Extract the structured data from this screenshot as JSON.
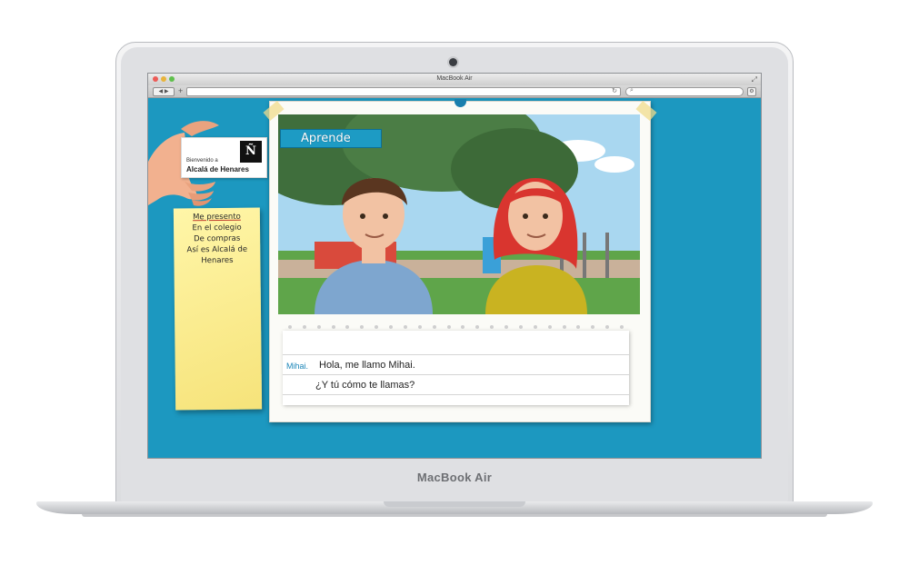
{
  "device": {
    "brand": "MacBook Air"
  },
  "window": {
    "title": "MacBook Air"
  },
  "card": {
    "line1": "Bienvenido a",
    "line2": "Alcalá de Henares",
    "logo_text": "Ñ"
  },
  "menu": {
    "items": [
      {
        "label": "Me presento"
      },
      {
        "label": "En el colegio"
      },
      {
        "label": "De compras"
      },
      {
        "label": "Así es Alcalá de"
      },
      {
        "label": "Henares"
      }
    ]
  },
  "panel": {
    "heading": "Aprende",
    "speaker": "Mihai.",
    "line1": "Hola, me llamo Mihai.",
    "line2": "¿Y tú cómo te llamas?"
  },
  "colors": {
    "screen_bg": "#1c98c0",
    "note": "#f6e37a",
    "label": "#1d9bc4"
  }
}
